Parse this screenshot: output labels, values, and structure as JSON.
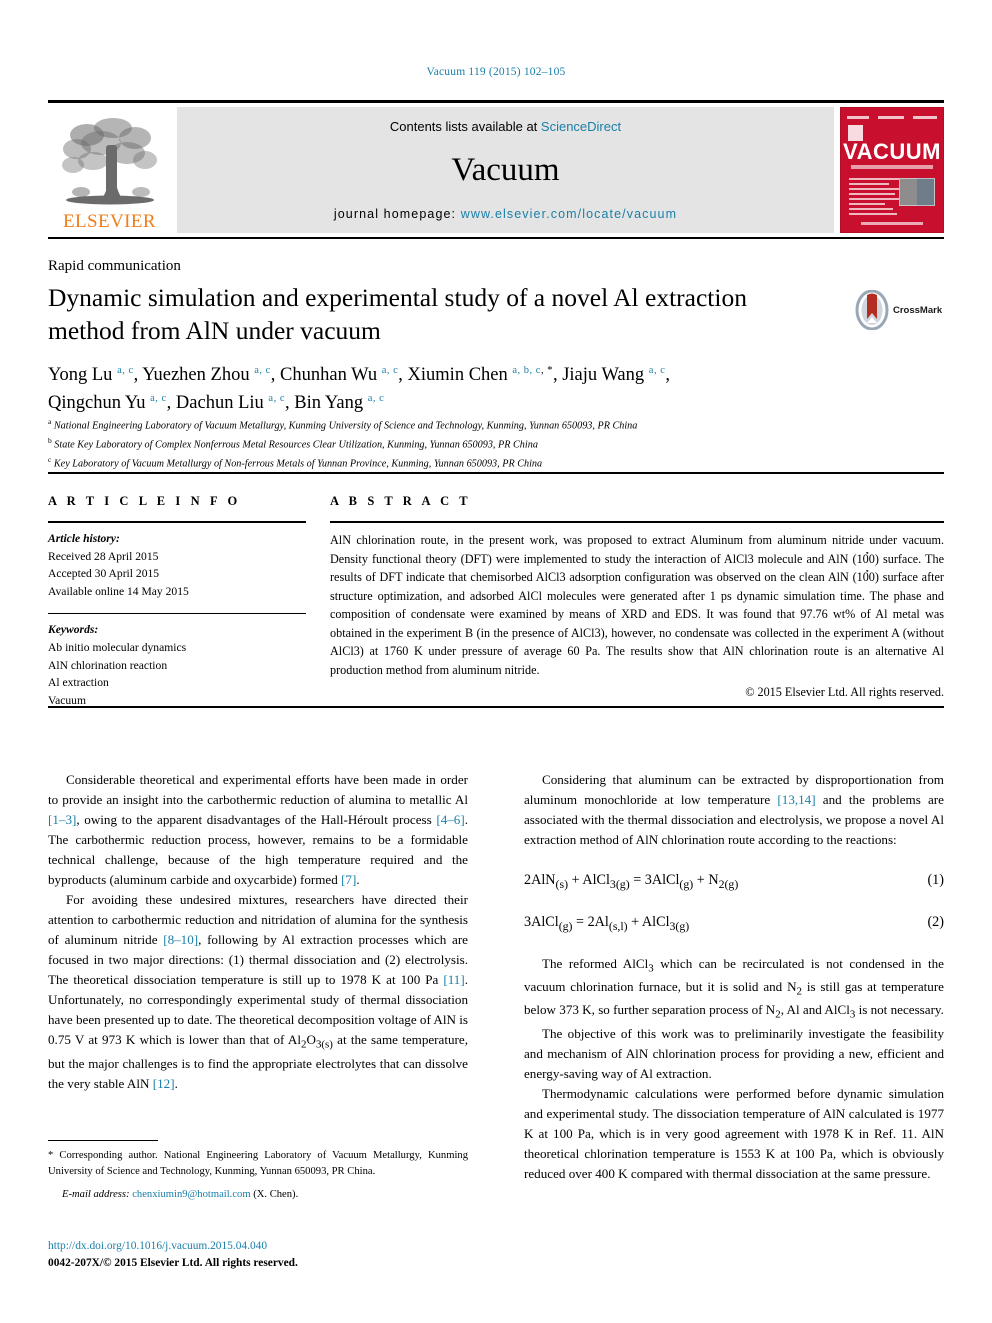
{
  "running_head": "Vacuum 119 (2015) 102–105",
  "masthead": {
    "contents_prefix": "Contents lists available at ",
    "contents_link": "ScienceDirect",
    "journal_title": "Vacuum",
    "homepage_label": "journal homepage: ",
    "homepage_url": "www.elsevier.com/locate/vacuum",
    "publisher_wordmark": "ELSEVIER",
    "cover_title": "VACUUM"
  },
  "article": {
    "type": "Rapid communication",
    "title": "Dynamic simulation and experimental study of a novel Al extraction method from AlN under vacuum",
    "crossmark_label": "CrossMark",
    "authors_line1": "Yong Lu a, c, Yuezhen Zhou a, c, Chunhan Wu a, c, Xiumin Chen a, b, c, *, Jiaju Wang a, c,",
    "authors_line2": "Qingchun Yu a, c, Dachun Liu a, c, Bin Yang a, c",
    "affiliations": [
      {
        "mark": "a",
        "text": "National Engineering Laboratory of Vacuum Metallurgy, Kunming University of Science and Technology, Kunming, Yunnan 650093, PR China"
      },
      {
        "mark": "b",
        "text": "State Key Laboratory of Complex Nonferrous Metal Resources Clear Utilization, Kunming, Yunnan 650093, PR China"
      },
      {
        "mark": "c",
        "text": "Key Laboratory of Vacuum Metallurgy of Non-ferrous Metals of Yunnan Province, Kunming, Yunnan 650093, PR China"
      }
    ]
  },
  "article_info": {
    "heading": "A R T I C L E   I N F O",
    "history_label": "Article history:",
    "history": [
      "Received 28 April 2015",
      "Accepted 30 April 2015",
      "Available online 14 May 2015"
    ],
    "keywords_label": "Keywords:",
    "keywords": [
      "Ab initio molecular dynamics",
      "AlN chlorination reaction",
      "Al extraction",
      "Vacuum"
    ]
  },
  "abstract": {
    "heading": "A B S T R A C T",
    "text": "AlN chlorination route, in the present work, was proposed to extract Aluminum from aluminum nitride under vacuum. Density functional theory (DFT) were implemented to study the interaction of AlCl3 molecule and AlN (10̉0) surface. The results of DFT indicate that chemisorbed AlCl3 adsorption configuration was observed on the clean AlN (10̉0) surface after structure optimization, and adsorbed AlCl molecules were generated after 1 ps dynamic simulation time. The phase and composition of condensate were examined by means of XRD and EDS. It was found that 97.76 wt% of Al metal was obtained in the experiment B (in the presence of AlCl3), however, no condensate was collected in the experiment A (without AlCl3) at 1760 K under pressure of average 60 Pa. The results show that AlN chlorination route is an alternative Al production method from aluminum nitride.",
    "copyright": "© 2015 Elsevier Ltd. All rights reserved."
  },
  "body": {
    "left_paragraphs": [
      "Considerable theoretical and experimental efforts have been made in order to provide an insight into the carbothermic reduction of alumina to metallic Al [1–3], owing to the apparent disadvantages of the Hall-Héroult process [4–6]. The carbothermic reduction process, however, remains to be a formidable technical challenge, because of the high temperature required and the byproducts (aluminum carbide and oxycarbide) formed [7].",
      "For avoiding these undesired mixtures, researchers have directed their attention to carbothermic reduction and nitridation of alumina for the synthesis of aluminum nitride [8–10], following by Al extraction processes which are focused in two major directions: (1) thermal dissociation and (2) electrolysis. The theoretical dissociation temperature is still up to 1978 K at 100 Pa [11]. Unfortunately, no correspondingly experimental study of thermal dissociation have been presented up to date. The theoretical decomposition voltage of AlN is 0.75 V at 973 K which is lower than that of Al2O3(s) at the same temperature, but the major challenges is to find the appropriate electrolytes that can dissolve the very stable AlN [12]."
    ],
    "right_paragraph_1": "Considering that aluminum can be extracted by disproportionation from aluminum monochloride at low temperature [13,14] and the problems are associated with the thermal dissociation and electrolysis, we propose a novel Al extraction method of AlN chlorination route according to the reactions:",
    "equations": [
      {
        "body": "2AlN(s) + AlCl3(g) = 3AlCl(g) + N2(g)",
        "number": "(1)"
      },
      {
        "body": "3AlCl(g) = 2Al(s,l) + AlCl3(g)",
        "number": "(2)"
      }
    ],
    "right_paragraphs_after": [
      "The reformed AlCl3 which can be recirculated is not condensed in the vacuum chlorination furnace, but it is solid and N2 is still gas at temperature below 373 K, so further separation process of N2, Al and AlCl3 is not necessary.",
      "The objective of this work was to preliminarily investigate the feasibility and mechanism of AlN chlorination process for providing a new, efficient and energy-saving way of Al extraction.",
      "Thermodynamic calculations were performed before dynamic simulation and experimental study. The dissociation temperature of AlN calculated is 1977 K at 100 Pa, which is in very good agreement with 1978 K in Ref. 11. AlN theoretical chlorination temperature is 1553 K at 100 Pa, which is obviously reduced over 400 K compared with thermal dissociation at the same pressure."
    ]
  },
  "footnote": {
    "corresponding": "* Corresponding author. National Engineering Laboratory of Vacuum Metallurgy, Kunming University of Science and Technology, Kunming, Yunnan 650093, PR China.",
    "email_label": "E-mail address:",
    "email": "chenxiumin9@hotmail.com",
    "email_suffix": "(X. Chen)."
  },
  "footer": {
    "doi": "http://dx.doi.org/10.1016/j.vacuum.2015.04.040",
    "issn_line": "0042-207X/© 2015 Elsevier Ltd. All rights reserved."
  },
  "colors": {
    "link_blue": "#1a7fa8",
    "elsevier_orange": "#ef7d1a",
    "cover_red": "#c8102e"
  }
}
